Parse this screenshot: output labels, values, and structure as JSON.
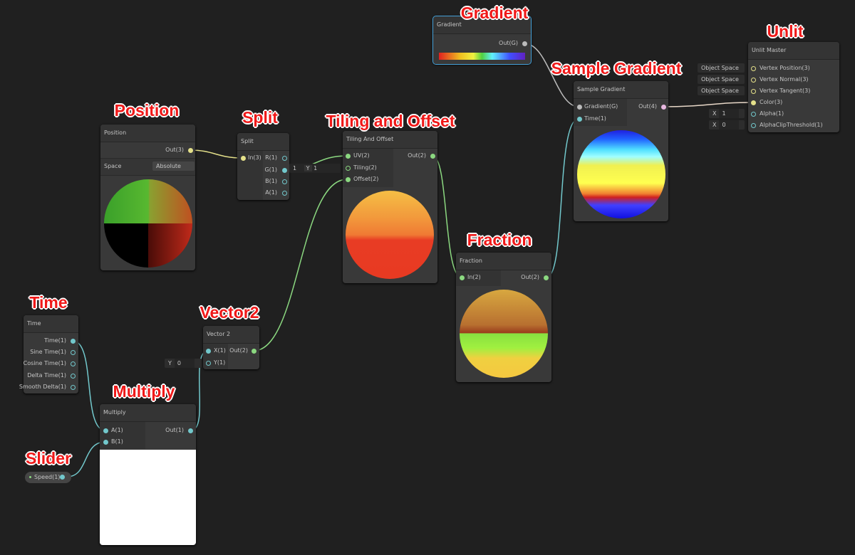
{
  "annotations": {
    "gradient": "Gradient",
    "unlit": "Unlit",
    "sample_gradient": "Sample Gradient",
    "position": "Position",
    "split": "Split",
    "tiling": "Tiling and Offset",
    "fraction": "Fraction",
    "time": "Time",
    "vector2": "Vector2",
    "multiply": "Multiply",
    "slider": "Slider"
  },
  "nodes": {
    "gradient": {
      "title": "Gradient",
      "out": "Out(G)"
    },
    "unlit": {
      "title": "Unlit Master",
      "inputs": [
        "Vertex Position(3)",
        "Vertex Normal(3)",
        "Vertex Tangent(3)",
        "Color(3)",
        "Alpha(1)",
        "AlphaClipThreshold(1)"
      ],
      "space_values": [
        "Object Space",
        "Object Space",
        "Object Space"
      ],
      "alpha": {
        "axis": "X",
        "value": "1"
      },
      "clip": {
        "axis": "X",
        "value": "0"
      }
    },
    "sample_gradient": {
      "title": "Sample Gradient",
      "inputs": [
        "Gradient(G)",
        "Time(1)"
      ],
      "out": "Out(4)"
    },
    "position": {
      "title": "Position",
      "out": "Out(3)",
      "space_label": "Space",
      "space_value": "Absolute Wo"
    },
    "split": {
      "title": "Split",
      "in": "In(3)",
      "outs": [
        "R(1)",
        "G(1)",
        "B(1)",
        "A(1)"
      ]
    },
    "tiling": {
      "title": "Tiling And Offset",
      "inputs": [
        "UV(2)",
        "Tiling(2)",
        "Offset(2)"
      ],
      "out": "Out(2)",
      "tiling_x": "1",
      "tiling_y_axis": "Y",
      "tiling_y": "1"
    },
    "fraction": {
      "title": "Fraction",
      "in": "In(2)",
      "out": "Out(2)"
    },
    "time": {
      "title": "Time",
      "outs": [
        "Time(1)",
        "Sine Time(1)",
        "Cosine Time(1)",
        "Delta Time(1)",
        "Smooth Delta(1)"
      ]
    },
    "vector2": {
      "title": "Vector 2",
      "inputs": [
        "X(1)",
        "Y(1)"
      ],
      "out": "Out(2)",
      "y_axis": "Y",
      "y_value": "0"
    },
    "multiply": {
      "title": "Multiply",
      "inputs": [
        "A(1)",
        "B(1)"
      ],
      "out": "Out(1)"
    },
    "slider": {
      "label": "Speed(1)"
    }
  },
  "colors": {
    "background": "#202020",
    "node": "#393939",
    "vec1": "#84e4e7",
    "vec2": "#9aef92",
    "vec3": "#f6ff9a",
    "vec4": "#fbcbf4",
    "gradient": "#c8c8c8",
    "annotation": "#f01818",
    "selected": "#44a0d8"
  }
}
